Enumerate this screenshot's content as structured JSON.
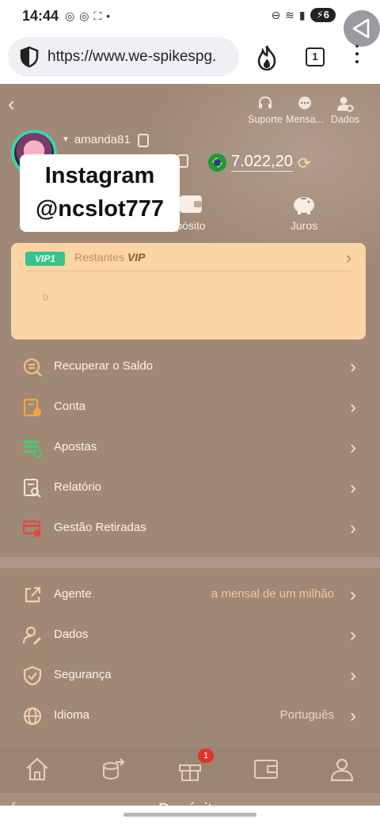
{
  "status_bar": {
    "time": "14:44",
    "battery": "6"
  },
  "browser": {
    "url": "https://www.we-spikespg.",
    "tab_count": "1"
  },
  "header": {
    "support_label": "Suporte",
    "messages_label": "Mensa...",
    "data_label": "Dados"
  },
  "profile": {
    "username": "amanda81",
    "balance": "7.022,20",
    "currency_flag": "brazil-flag-icon"
  },
  "quick_actions": {
    "deposit_label": "pósito",
    "interest_label": "Juros"
  },
  "overlay": {
    "line1": "Instagram",
    "line2": "@ncslot777"
  },
  "vip": {
    "badge": "VIP1",
    "remaining_label": "Restantes",
    "vip_word": "VIP",
    "value": "0"
  },
  "menu": {
    "group1": [
      {
        "label": "Recuperar o Saldo",
        "icon": "recover-balance-icon"
      },
      {
        "label": "Conta",
        "icon": "account-icon"
      },
      {
        "label": "Apostas",
        "icon": "bets-icon"
      },
      {
        "label": "Relatório",
        "icon": "report-icon"
      },
      {
        "label": "Gestão Retiradas",
        "icon": "withdrawal-icon"
      }
    ],
    "group2": [
      {
        "label": "Agente",
        "value": "a mensal de um milhão",
        "icon": "share-icon"
      },
      {
        "label": "Dados",
        "value": "",
        "icon": "user-edit-icon"
      },
      {
        "label": "Segurança",
        "value": "",
        "icon": "shield-icon"
      },
      {
        "label": "Idioma",
        "value": "Português",
        "icon": "globe-icon"
      }
    ]
  },
  "bottom_nav": {
    "gift_badge": "1"
  },
  "deposit_bar": {
    "label": "Depósito"
  }
}
